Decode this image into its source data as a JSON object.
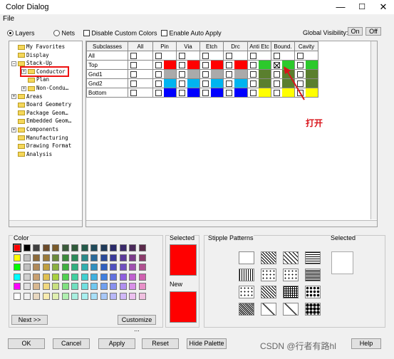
{
  "window": {
    "title": "Color Dialog",
    "min": "—",
    "max": "☐",
    "close": "✕"
  },
  "menu": {
    "file": "File"
  },
  "options": {
    "layers": "Layers",
    "nets": "Nets",
    "disable_custom_colors": "Disable Custom Colors",
    "enable_auto_apply": "Enable Auto Apply",
    "global_visibility": "Global Visibility:",
    "on": "On",
    "off": "Off"
  },
  "tree": [
    {
      "label": "My Favorites",
      "indent": 0,
      "expander": ""
    },
    {
      "label": "Display",
      "indent": 0,
      "expander": ""
    },
    {
      "label": "Stack-Up",
      "indent": 0,
      "expander": "−"
    },
    {
      "label": "Conductor",
      "indent": 1,
      "expander": "+",
      "selected": true
    },
    {
      "label": "Plan",
      "indent": 1,
      "expander": ""
    },
    {
      "label": "Non-Condu…",
      "indent": 1,
      "expander": "+"
    },
    {
      "label": "Areas",
      "indent": 0,
      "expander": "+"
    },
    {
      "label": "Board Geometry",
      "indent": 0,
      "expander": ""
    },
    {
      "label": "Package Geom…",
      "indent": 0,
      "expander": ""
    },
    {
      "label": "Embedded Geom…",
      "indent": 0,
      "expander": ""
    },
    {
      "label": "Components",
      "indent": 0,
      "expander": "+"
    },
    {
      "label": "Manufacturing",
      "indent": 0,
      "expander": ""
    },
    {
      "label": "Drawing Format",
      "indent": 0,
      "expander": ""
    },
    {
      "label": "Analysis",
      "indent": 0,
      "expander": ""
    }
  ],
  "grid": {
    "columns": [
      "Subclasses",
      "All",
      "Pin",
      "Via",
      "Etch",
      "Drc",
      "Anti Etc",
      "Bound.",
      "Cavity"
    ],
    "rows": [
      {
        "name": "All",
        "colors": [
          "#ffffff",
          "#ffffff",
          "#ffffff",
          "#ffffff",
          "#ffffff",
          "#ffffff",
          "#ffffff",
          "#ffffff"
        ]
      },
      {
        "name": "Top",
        "colors": [
          "#ffffff",
          "#ff0000",
          "#ff0000",
          "#ff0000",
          "#ff0000",
          "#2cc92c",
          "#2cc92c",
          "#2cc92c"
        ],
        "checked_col": 6
      },
      {
        "name": "Gnd1",
        "colors": [
          "#ffffff",
          "#aaaaaa",
          "#aaaaaa",
          "#aaaaaa",
          "#aaaaaa",
          "#5a7f2e",
          "#5a7f2e",
          "#5a7f2e"
        ]
      },
      {
        "name": "Gnd2",
        "colors": [
          "#ffffff",
          "#00b4f0",
          "#00b4f0",
          "#00b4f0",
          "#00b4f0",
          "#5a7f2e",
          "#5a7f2e",
          "#5a7f2e"
        ]
      },
      {
        "name": "Bottom",
        "colors": [
          "#ffffff",
          "#0000ff",
          "#0000ff",
          "#0000ff",
          "#0000ff",
          "#ffff00",
          "#ffff00",
          "#ffff00"
        ]
      }
    ]
  },
  "annotation": {
    "text": "打开",
    "color": "#d9141b"
  },
  "color_panel": {
    "title": "Color",
    "next": "Next >>",
    "customize": "Customize ...",
    "palette": [
      [
        "#ff0000",
        "#000000",
        "#404040",
        "#6b4a2a",
        "#7a5a2a",
        "#3a5a3a",
        "#2f5a3a",
        "#235a4a",
        "#1f4a5a",
        "#1f3a5a",
        "#2a2a6a",
        "#3a2a6a",
        "#4a2a5a",
        "#5a2a4a"
      ],
      [
        "#ffff00",
        "#bfbfbf",
        "#8c6a3a",
        "#9a7a3a",
        "#6a8a3a",
        "#3a8a3a",
        "#2a8a5a",
        "#2a8a8a",
        "#2a6a9a",
        "#2a4a9a",
        "#3a3a9a",
        "#5a3a9a",
        "#7a3a8a",
        "#8a3a6a"
      ],
      [
        "#00ff00",
        "#c0c0c0",
        "#b08a5a",
        "#c0a040",
        "#8ab040",
        "#40b040",
        "#30b080",
        "#30b0b0",
        "#3090c0",
        "#3060c0",
        "#5050c0",
        "#7050c0",
        "#a050b0",
        "#b05090"
      ],
      [
        "#00ffff",
        "#d0d0d0",
        "#c8a070",
        "#e0c050",
        "#a8d040",
        "#50d050",
        "#40d0a0",
        "#40d0d0",
        "#40b0e0",
        "#4080e0",
        "#6070e0",
        "#9060e0",
        "#c060d0",
        "#d060b0"
      ],
      [
        "#ff00ff",
        "#e0e0e0",
        "#d8b890",
        "#f0d880",
        "#c8e080",
        "#80e080",
        "#70e0c0",
        "#70e0e0",
        "#70c8f0",
        "#70a0f0",
        "#8890f0",
        "#b090f0",
        "#d890e8",
        "#e890c8"
      ],
      [
        "#ffffff",
        "#f0f0f0",
        "#e8d8c0",
        "#f8ecb0",
        "#e0f0b0",
        "#b0f0b0",
        "#a8f0e0",
        "#a8f0f0",
        "#a8e0f8",
        "#a8c8f8",
        "#b8b8f8",
        "#d0b8f8",
        "#ecc0f0",
        "#f0c0e0"
      ]
    ]
  },
  "selected": {
    "label": "Selected",
    "color": "#ff0000"
  },
  "new": {
    "label": "New",
    "color": "#ff0000"
  },
  "stipple": {
    "title": "Stipple Patterns",
    "selected": "Selected"
  },
  "buttons": {
    "ok": "OK",
    "cancel": "Cancel",
    "apply": "Apply",
    "reset": "Reset",
    "hide": "Hide Palette",
    "help": "Help"
  },
  "watermark": "CSDN @行者有路hl"
}
